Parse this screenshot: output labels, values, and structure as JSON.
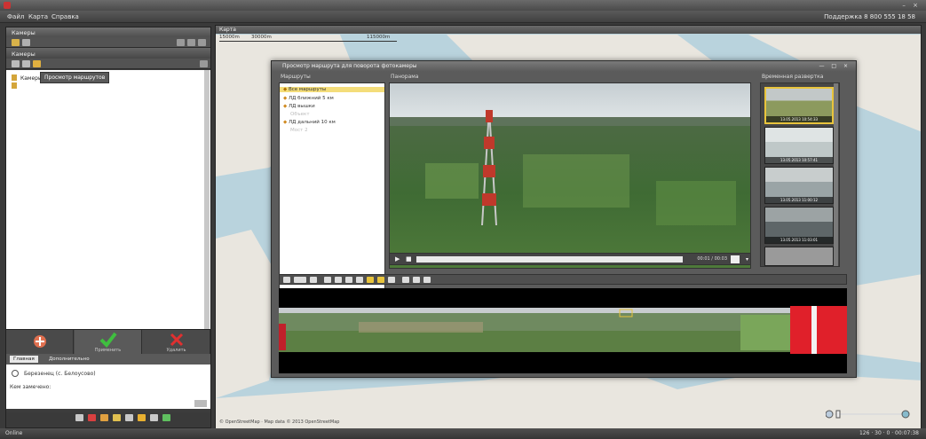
{
  "menu": {
    "items": [
      "Файл",
      "Карта",
      "Справка"
    ],
    "support": "Поддержка 8 800 555 18 58"
  },
  "left_panel": {
    "header": "Камеры",
    "cameras_header": "Камеры",
    "tooltip": "Просмотр маршрутов",
    "tree": {
      "node": "Камеры"
    },
    "actions": {
      "add": "",
      "ok": "Применить",
      "delete": "Удалить"
    },
    "tabs": {
      "main": "Главная",
      "extra": "Дополнительно"
    },
    "details": {
      "camera": "Березенец (с. Белоусово)",
      "label": "Кем замечено:"
    }
  },
  "map": {
    "header": "Карта",
    "scale": [
      "15000m",
      "30000m",
      "115000m"
    ],
    "attribution": "© OpenStreetMap · Map data © 2013 OpenStreetMap"
  },
  "dialog": {
    "title": "Просмотр маршрута для поворота фотокамеры",
    "controls": "— □ ×",
    "routes_label": "Маршруты",
    "panorama_label": "Панорама",
    "time_label": "Временная развертка",
    "routes": [
      {
        "label": "Все маршруты",
        "selected": true
      },
      {
        "label": "ЛД ближний 5 км",
        "selected": false
      },
      {
        "label": "ЛД вышки",
        "selected": false
      },
      {
        "label": "Объект",
        "selected": false
      },
      {
        "label": "ЛД дальний 10 км",
        "selected": false
      },
      {
        "label": "Мост 2",
        "selected": false
      }
    ],
    "player": {
      "time": "00:01 / 00:03"
    },
    "thumbnails": [
      {
        "caption": "13.05.2013 10:54:33",
        "selected": true,
        "tone": "#8c9a5e"
      },
      {
        "caption": "13.05.2013 10:57:41",
        "selected": false,
        "tone": "#bfc8c8"
      },
      {
        "caption": "13.05.2013 11:00:12",
        "selected": false,
        "tone": "#9aa4a6"
      },
      {
        "caption": "13.05.2013 11:03:01",
        "selected": false,
        "tone": "#5e6668"
      },
      {
        "caption": "",
        "selected": false,
        "tone": "#9a9a9a"
      }
    ]
  },
  "status": {
    "left": "Online",
    "right": "126 · 30 · 0 · 00:07:38"
  },
  "colors": {
    "accent": "#e8c43c",
    "map_water": "#b9d3dd",
    "map_land": "#e9e6df"
  }
}
